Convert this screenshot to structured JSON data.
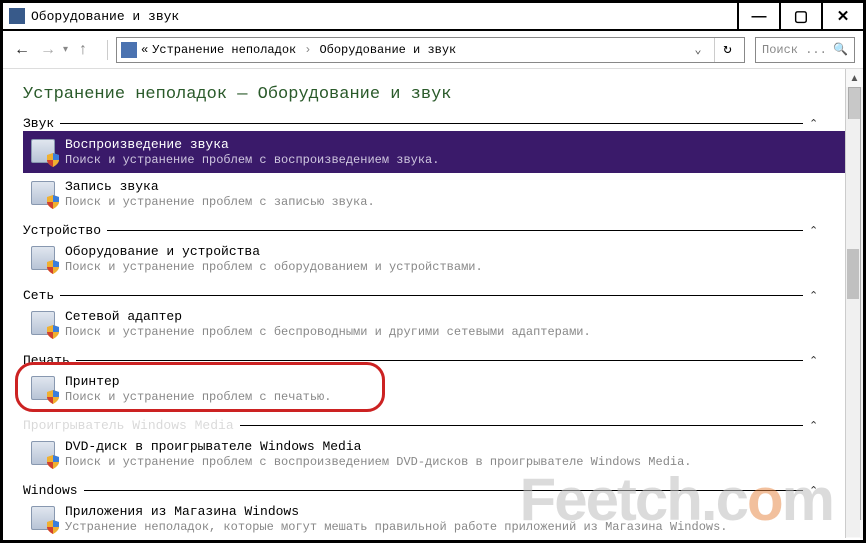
{
  "window": {
    "title": "Оборудование и звук"
  },
  "nav": {
    "crumb_prefix": "«",
    "crumb1": "Устранение неполадок",
    "crumb2": "Оборудование и звук"
  },
  "search": {
    "placeholder": "Поиск ..."
  },
  "page_title": "Устранение неполадок — Оборудование и звук",
  "sections": [
    {
      "label": "Звук",
      "items": [
        {
          "title": "Воспроизведение звука",
          "desc": "Поиск и устранение проблем с воспроизведением звука.",
          "selected": true,
          "icon": "speaker-icon"
        },
        {
          "title": "Запись звука",
          "desc": "Поиск и устранение проблем с записью звука.",
          "icon": "microphone-icon"
        }
      ]
    },
    {
      "label": "Устройство",
      "items": [
        {
          "title": "Оборудование и устройства",
          "desc": "Поиск и устранение проблем с оборудованием и устройствами.",
          "icon": "device-icon"
        }
      ]
    },
    {
      "label": "Сеть",
      "items": [
        {
          "title": "Сетевой адаптер",
          "desc": "Поиск и устранение проблем с беспроводными и другими сетевыми адаптерами.",
          "icon": "network-icon"
        }
      ]
    },
    {
      "label": "Печать",
      "items": [
        {
          "title": "Принтер",
          "desc": "Поиск и устранение проблем с печатью.",
          "icon": "printer-icon",
          "highlighted": true
        }
      ]
    },
    {
      "label": "Проигрыватель Windows Media",
      "partially_obscured": true,
      "items": [
        {
          "title": "DVD-диск в проигрывателе Windows Media",
          "desc": "Поиск и устранение проблем с воспроизведением DVD-дисков в проигрывателе Windows Media.",
          "icon": "dvd-icon"
        }
      ]
    },
    {
      "label": "Windows",
      "items": [
        {
          "title": "Приложения из Магазина Windows",
          "desc": "Устранение неполадок, которые могут мешать правильной работе приложений из Магазина Windows.",
          "icon": "store-icon"
        }
      ]
    }
  ],
  "watermark": "Feetch.com"
}
